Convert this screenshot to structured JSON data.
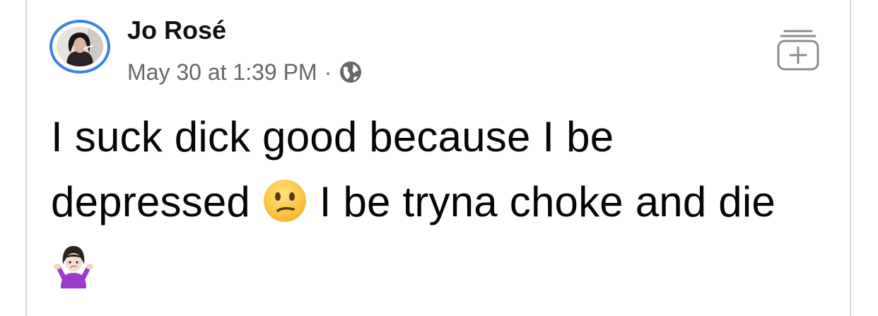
{
  "post": {
    "author_name": "Jo Rosé",
    "timestamp": "May 30 at 1:39 PM",
    "separator": "·",
    "privacy_icon": "globe-icon",
    "text_part1": "I suck dick good because I be depressed ",
    "emoji1": "confused-face-emoji",
    "text_part2": " I be tryna choke and die ",
    "emoji2": "woman-shrugging-emoji"
  },
  "actions": {
    "add_icon": "add-to-collection-icon"
  },
  "colors": {
    "avatar_ring": "#3b82e6",
    "meta_text": "#65676b",
    "body_text": "#050505",
    "card_border": "#d6d9dd"
  }
}
